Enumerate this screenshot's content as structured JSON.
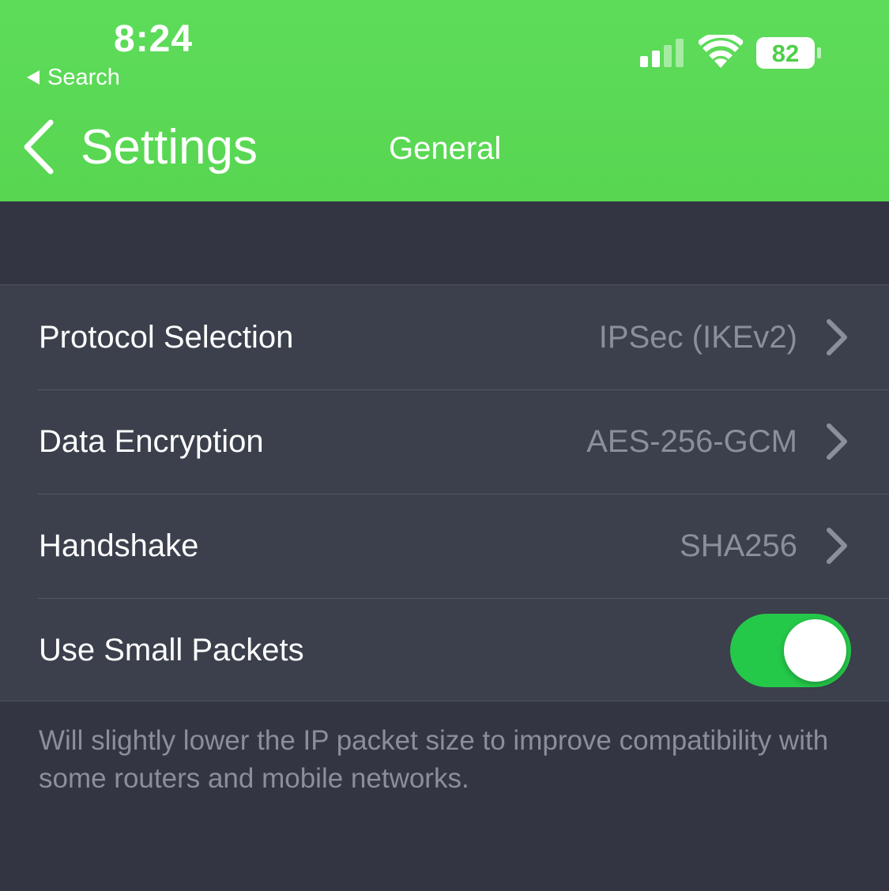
{
  "status_bar": {
    "time": "8:24",
    "back_app": "Search",
    "battery_level": "82",
    "signal_bars_active": 2,
    "signal_bars_total": 4
  },
  "nav": {
    "back_label": "Settings",
    "title": "General"
  },
  "settings": {
    "rows": [
      {
        "label": "Protocol Selection",
        "value": "IPSec (IKEv2)",
        "type": "disclosure"
      },
      {
        "label": "Data Encryption",
        "value": "AES-256-GCM",
        "type": "disclosure"
      },
      {
        "label": "Handshake",
        "value": "SHA256",
        "type": "disclosure"
      },
      {
        "label": "Use Small Packets",
        "type": "toggle",
        "on": true
      }
    ],
    "footer": "Will slightly lower the IP packet size to improve compatibility with some routers and mobile networks."
  },
  "colors": {
    "accent_green": "#5ddc5a",
    "toggle_on": "#25c94a",
    "background": "#333642",
    "group_background": "#3b404c"
  }
}
